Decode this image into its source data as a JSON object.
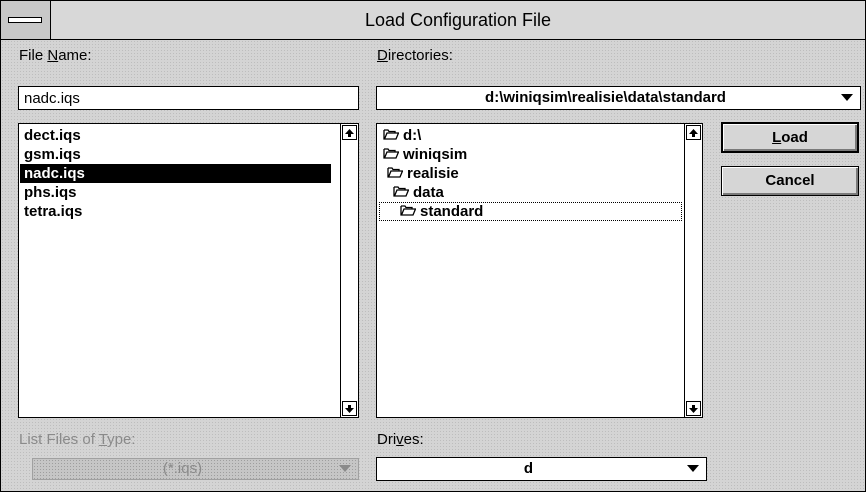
{
  "window": {
    "title": "Load Configuration File",
    "system_menu_icon": "system-menu-bar-icon"
  },
  "file_name": {
    "label_mnemonic": "N",
    "label_pre": "File ",
    "label_post": "ame:",
    "value": "nadc.iqs"
  },
  "files": {
    "items": [
      "dect.iqs",
      "gsm.iqs",
      "nadc.iqs",
      "phs.iqs",
      "tetra.iqs"
    ],
    "selected": "nadc.iqs",
    "scroll_up_icon": "scroll-up-arrow-icon",
    "scroll_down_icon": "scroll-down-arrow-icon"
  },
  "directories": {
    "label_mnemonic": "D",
    "label_post": "irectories:",
    "current_path": "d:\\winiqsim\\realisie\\data\\standard",
    "tree": [
      {
        "label": "d:\\",
        "icon": "open-folder-icon"
      },
      {
        "label": "winiqsim",
        "icon": "open-folder-icon"
      },
      {
        "label": "realisie",
        "icon": "open-folder-icon"
      },
      {
        "label": "data",
        "icon": "open-folder-icon"
      },
      {
        "label": "standard",
        "icon": "open-folder-icon"
      }
    ],
    "focused": "standard",
    "dropdown_icon": "dropdown-arrow-icon"
  },
  "list_type": {
    "label_pre": "List Files of ",
    "label_mnemonic": "T",
    "label_post": "ype:",
    "value": "(*.iqs)",
    "enabled": false,
    "dropdown_icon": "dropdown-arrow-icon"
  },
  "drives": {
    "label_pre": "Dri",
    "label_mnemonic": "v",
    "label_post": "es:",
    "value": "d",
    "dropdown_icon": "dropdown-arrow-icon"
  },
  "buttons": {
    "load_mnemonic": "L",
    "load_post": "oad",
    "cancel": "Cancel"
  },
  "colors": {
    "dialog_bg": "#d4d4d4",
    "selection_bg": "#000000",
    "selection_fg": "#ffffff",
    "disabled_text": "#8a8a8a"
  }
}
